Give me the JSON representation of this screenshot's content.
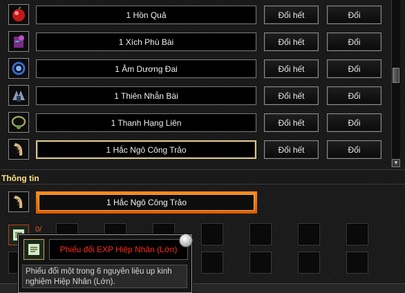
{
  "exchange_list": {
    "items": [
      {
        "name": "1 Hồn Quả",
        "icon": "red-orb-icon",
        "exchange_all_label": "Đổi hết",
        "exchange_label": "Đổi"
      },
      {
        "name": "1 Xích Phù Bài",
        "icon": "purple-talisman-icon",
        "exchange_all_label": "Đổi hết",
        "exchange_label": "Đổi"
      },
      {
        "name": "1 Âm Dương Đai",
        "icon": "blue-belt-icon",
        "exchange_all_label": "Đổi hết",
        "exchange_label": "Đổi"
      },
      {
        "name": "1 Thiên Nhẫn Bài",
        "icon": "wing-plaque-icon",
        "exchange_all_label": "Đổi hết",
        "exchange_label": "Đổi"
      },
      {
        "name": "1 Thanh Hạng Liên",
        "icon": "green-necklace-icon",
        "exchange_all_label": "Đổi hết",
        "exchange_label": "Đổi"
      },
      {
        "name": "1 Hắc Ngô Công Trảo",
        "icon": "claw-icon",
        "exchange_all_label": "Đổi hết",
        "exchange_label": "Đổi",
        "selected": true
      }
    ],
    "scroll_down_icon": "arrow-down-icon"
  },
  "info": {
    "title": "Thông tin",
    "selected_item_name": "1 Hắc Ngô Công Trảo",
    "selected_item_icon": "claw-icon",
    "material_icon": "exp-voucher-icon",
    "material_count": "0/"
  },
  "tooltip": {
    "title": "Phiếu đổi EXP Hiệp Nhân (Lớn)",
    "description": "Phiếu đổi một trong 6 nguyên liệu up kinh nghiệm Hiệp Nhân (Lớn).",
    "icon": "exp-voucher-icon",
    "close_icon": "close-orb-icon"
  },
  "colors": {
    "accent_orange": "#ff8a1a",
    "title_gold": "#ffe08a",
    "tooltip_title_red": "#ff2a1e"
  }
}
